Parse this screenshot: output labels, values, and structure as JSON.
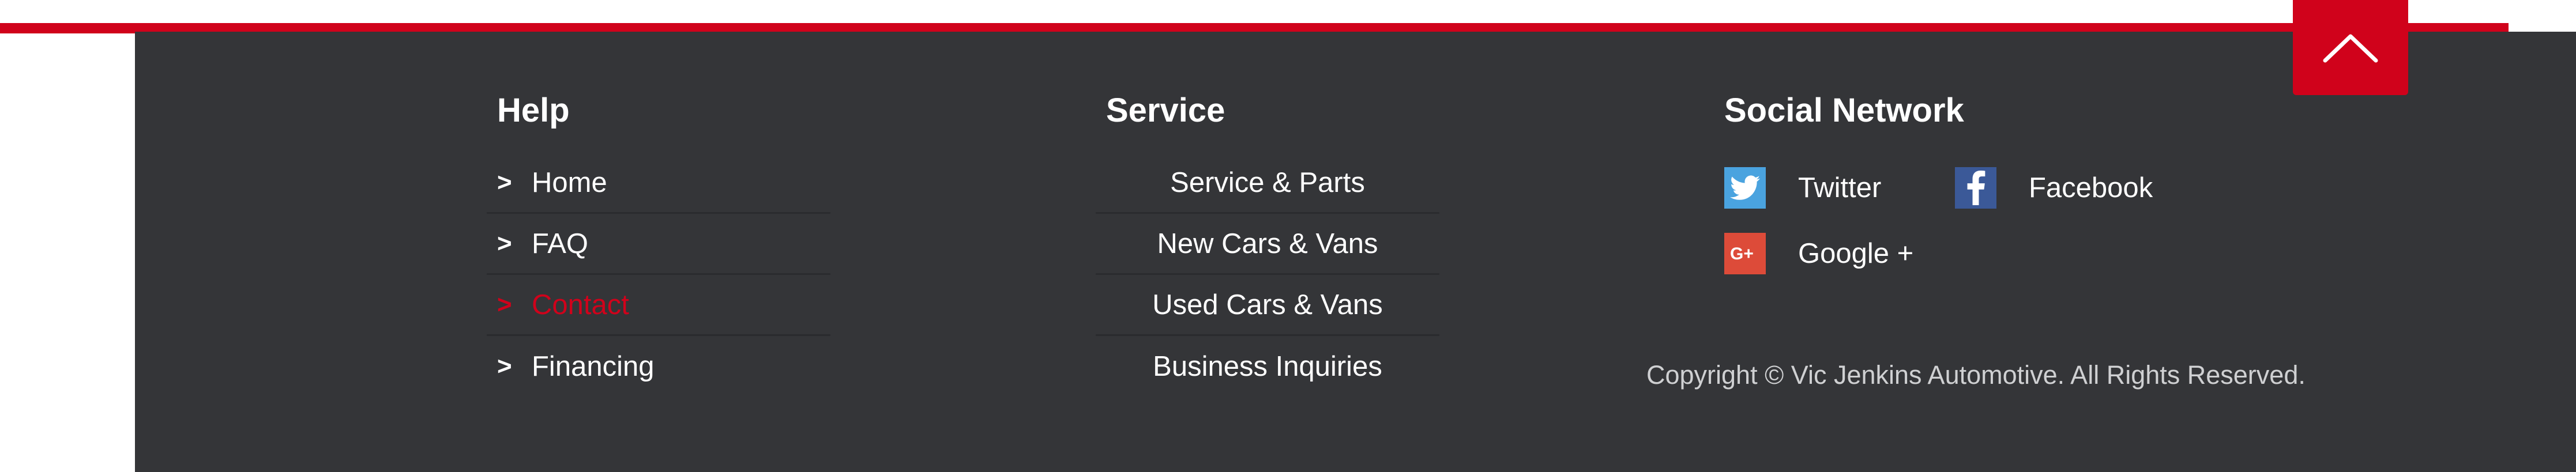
{
  "colors": {
    "accent": "#d0021b",
    "footer_bg": "#343538",
    "text": "#ffffff",
    "twitter": "#4aa3df",
    "facebook": "#3b5998",
    "google_plus": "#dd4b39"
  },
  "scroll_top": {
    "icon": "chevron-up-icon"
  },
  "help": {
    "title": "Help",
    "items": [
      {
        "label": "Home",
        "arrow": ">",
        "active": false
      },
      {
        "label": "FAQ",
        "arrow": ">",
        "active": false
      },
      {
        "label": "Contact",
        "arrow": ">",
        "active": true
      },
      {
        "label": "Financing",
        "arrow": ">",
        "active": false
      }
    ]
  },
  "service": {
    "title": "Service",
    "items": [
      {
        "label": "Service & Parts"
      },
      {
        "label": "New Cars & Vans"
      },
      {
        "label": "Used Cars & Vans"
      },
      {
        "label": "Business Inquiries"
      }
    ]
  },
  "social": {
    "title": "Social Network",
    "items": [
      {
        "label": "Twitter",
        "icon": "twitter-icon"
      },
      {
        "label": "Facebook",
        "icon": "facebook-icon"
      },
      {
        "label": "Google +",
        "icon": "google-plus-icon"
      }
    ]
  },
  "copyright": "Copyright © Vic Jenkins Automotive. All Rights Reserved."
}
